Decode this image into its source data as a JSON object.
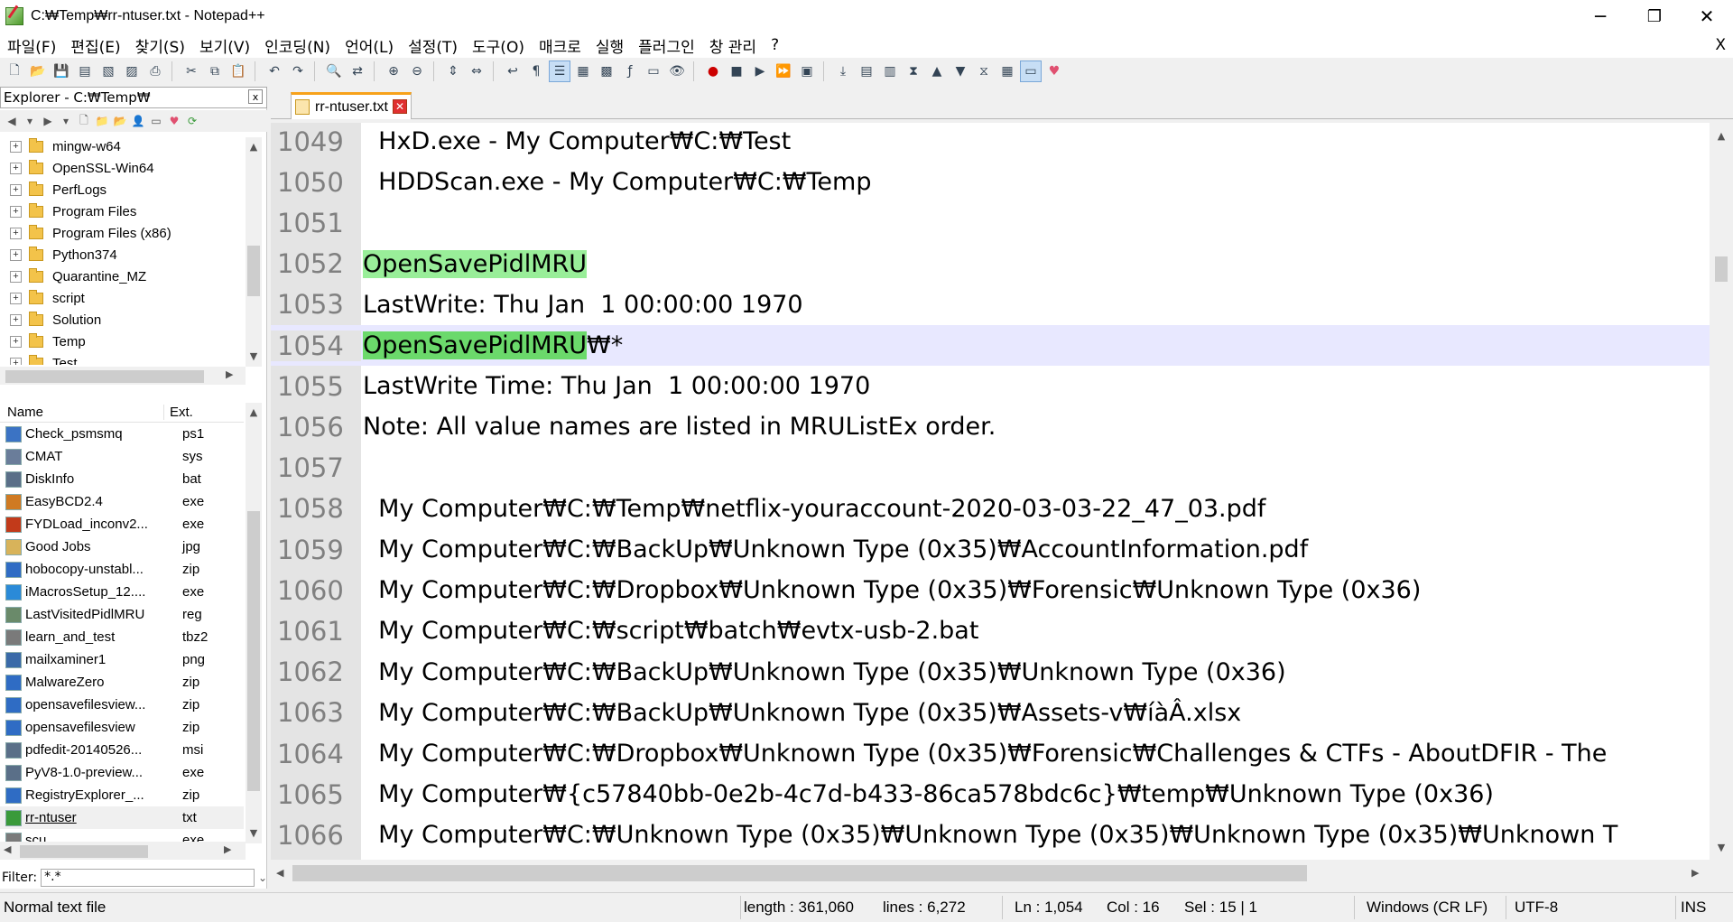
{
  "window": {
    "title": "C:₩Temp₩rr-ntuser.txt - Notepad++",
    "minimize": "─",
    "restore": "❐",
    "close": "✕"
  },
  "menu": [
    "파일(F)",
    "편집(E)",
    "찾기(S)",
    "보기(V)",
    "인코딩(N)",
    "언어(L)",
    "설정(T)",
    "도구(O)",
    "매크로",
    "실행",
    "플러그인",
    "창 관리",
    "?"
  ],
  "menu_close": "X",
  "explorer": {
    "title": "Explorer - C:₩Temp₩",
    "close": "x",
    "tree": [
      "mingw-w64",
      "OpenSSL-Win64",
      "PerfLogs",
      "Program Files",
      "Program Files (x86)",
      "Python374",
      "Quarantine_MZ",
      "script",
      "Solution",
      "Temp",
      "Test"
    ],
    "columns": {
      "name": "Name",
      "ext": "Ext."
    },
    "files": [
      {
        "name": "Check_psmsmq",
        "ext": "ps1"
      },
      {
        "name": "CMAT",
        "ext": "sys"
      },
      {
        "name": "DiskInfo",
        "ext": "bat"
      },
      {
        "name": "EasyBCD2.4",
        "ext": "exe"
      },
      {
        "name": "FYDLoad_inconv2...",
        "ext": "exe"
      },
      {
        "name": "Good Jobs",
        "ext": "jpg"
      },
      {
        "name": "hobocopy-unstabl...",
        "ext": "zip"
      },
      {
        "name": "iMacrosSetup_12....",
        "ext": "exe"
      },
      {
        "name": "LastVisitedPidlMRU",
        "ext": "reg"
      },
      {
        "name": "learn_and_test",
        "ext": "tbz2"
      },
      {
        "name": "mailxaminer1",
        "ext": "png"
      },
      {
        "name": "MalwareZero",
        "ext": "zip"
      },
      {
        "name": "opensavefilesview...",
        "ext": "zip"
      },
      {
        "name": "opensavefilesview",
        "ext": "zip"
      },
      {
        "name": "pdfedit-20140526...",
        "ext": "msi"
      },
      {
        "name": "PyV8-1.0-preview...",
        "ext": "exe"
      },
      {
        "name": "RegistryExplorer_...",
        "ext": "zip"
      },
      {
        "name": "rr-ntuser",
        "ext": "txt"
      },
      {
        "name": "scu",
        "ext": "exe"
      }
    ],
    "filter_label": "Filter:",
    "filter_value": "*.*"
  },
  "tab": {
    "label": "rr-ntuser.txt",
    "close": "✕"
  },
  "editor": {
    "lines": [
      {
        "n": "1049",
        "pre": "",
        "hl": "",
        "post": "  HxD.exe - My Computer₩C:₩Test"
      },
      {
        "n": "1050",
        "pre": "",
        "hl": "",
        "post": "  HDDScan.exe - My Computer₩C:₩Temp"
      },
      {
        "n": "1051",
        "pre": "",
        "hl": "",
        "post": ""
      },
      {
        "n": "1052",
        "pre": "",
        "hl": "OpenSavePidlMRU",
        "post": ""
      },
      {
        "n": "1053",
        "pre": "",
        "hl": "",
        "post": "LastWrite: Thu Jan  1 00:00:00 1970"
      },
      {
        "n": "1054",
        "pre": "",
        "hl": "OpenSavePidlMRU",
        "post": "₩*"
      },
      {
        "n": "1055",
        "pre": "",
        "hl": "",
        "post": "LastWrite Time: Thu Jan  1 00:00:00 1970"
      },
      {
        "n": "1056",
        "pre": "",
        "hl": "",
        "post": "Note: All value names are listed in MRUListEx order."
      },
      {
        "n": "1057",
        "pre": "",
        "hl": "",
        "post": ""
      },
      {
        "n": "1058",
        "pre": "",
        "hl": "",
        "post": "  My Computer₩C:₩Temp₩netflix-youraccount-2020-03-03-22_47_03.pdf"
      },
      {
        "n": "1059",
        "pre": "",
        "hl": "",
        "post": "  My Computer₩C:₩BackUp₩Unknown Type (0x35)₩AccountInformation.pdf"
      },
      {
        "n": "1060",
        "pre": "",
        "hl": "",
        "post": "  My Computer₩C:₩Dropbox₩Unknown Type (0x35)₩Forensic₩Unknown Type (0x36)"
      },
      {
        "n": "1061",
        "pre": "",
        "hl": "",
        "post": "  My Computer₩C:₩script₩batch₩evtx-usb-2.bat"
      },
      {
        "n": "1062",
        "pre": "",
        "hl": "",
        "post": "  My Computer₩C:₩BackUp₩Unknown Type (0x35)₩Unknown Type (0x36)"
      },
      {
        "n": "1063",
        "pre": "",
        "hl": "",
        "post": "  My Computer₩C:₩BackUp₩Unknown Type (0x35)₩Assets-v₩íàÂ.xlsx"
      },
      {
        "n": "1064",
        "pre": "",
        "hl": "",
        "post": "  My Computer₩C:₩Dropbox₩Unknown Type (0x35)₩Forensic₩Challenges & CTFs - AboutDFIR - The"
      },
      {
        "n": "1065",
        "pre": "",
        "hl": "",
        "post": "  My Computer₩{c57840bb-0e2b-4c7d-b433-86ca578bdc6c}₩temp₩Unknown Type (0x36)"
      },
      {
        "n": "1066",
        "pre": "",
        "hl": "",
        "post": "  My Computer₩C:₩Unknown Type (0x35)₩Unknown Type (0x35)₩Unknown Type (0x35)₩Unknown T"
      }
    ]
  },
  "status": {
    "type": "Normal text file",
    "length": "length : 361,060",
    "lines": "lines : 6,272",
    "ln": "Ln : 1,054",
    "col": "Col : 16",
    "sel": "Sel : 15 | 1",
    "eol": "Windows (CR LF)",
    "enc": "UTF-8",
    "mode": "INS"
  }
}
